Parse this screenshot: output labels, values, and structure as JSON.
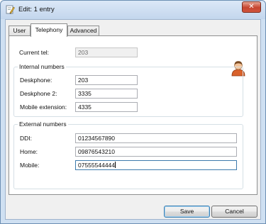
{
  "window": {
    "title": "Edit: 1 entry",
    "close_glyph": "✕"
  },
  "tabs": [
    {
      "label": "User",
      "active": false
    },
    {
      "label": "Telephony",
      "active": true
    },
    {
      "label": "Advanced",
      "active": false
    }
  ],
  "current_tel": {
    "label": "Current tel:",
    "value": "203"
  },
  "internal": {
    "title": "Internal numbers",
    "deskphone": {
      "label": "Deskphone:",
      "value": "203"
    },
    "deskphone2": {
      "label": "Deskphone 2:",
      "value": "3335"
    },
    "mobile_ext": {
      "label": "Mobile extension:",
      "value": "4335"
    }
  },
  "external": {
    "title": "External numbers",
    "ddi": {
      "label": "DDI:",
      "value": "01234567890"
    },
    "home": {
      "label": "Home:",
      "value": "09876543210"
    },
    "mobile": {
      "label": "Mobile:",
      "value": "07555544444"
    }
  },
  "buttons": {
    "save": "Save",
    "cancel": "Cancel"
  },
  "icons": {
    "app": "edit-document-icon",
    "user": "user-avatar-icon"
  },
  "colors": {
    "close_red": "#c6452f",
    "title_bar": "#c3d6ed",
    "focus_border": "#3d7bad"
  }
}
